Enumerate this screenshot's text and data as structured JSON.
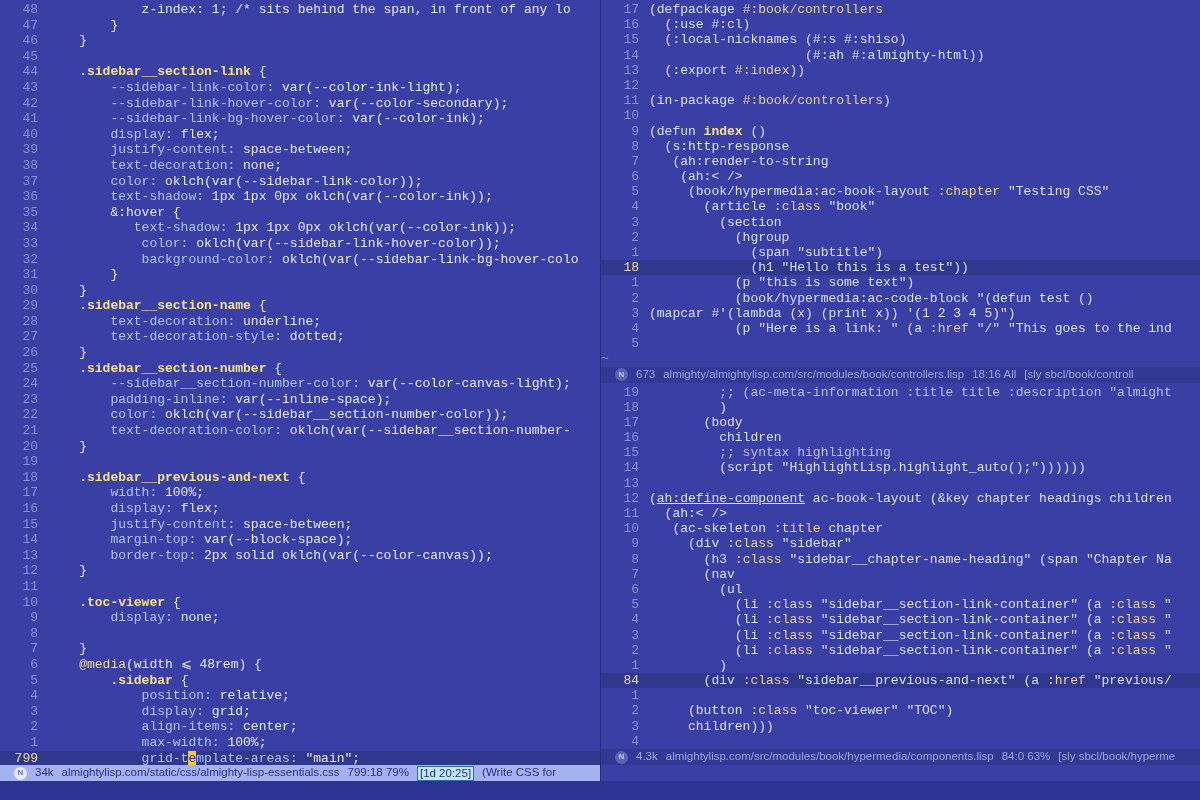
{
  "panes": [
    {
      "lines": [
        {
          "number": "48",
          "current": false,
          "segments": [
            {
              "kind": "val",
              "text": "            z-index: 1; /* sits behind the span, in front of any lo"
            }
          ]
        },
        {
          "number": "47",
          "current": false,
          "segments": [
            {
              "kind": "val",
              "text": "        }"
            }
          ]
        },
        {
          "number": "46",
          "current": false,
          "segments": [
            {
              "kind": "val",
              "text": "    }"
            }
          ]
        },
        {
          "number": "45",
          "current": false
        },
        {
          "number": "44",
          "current": false,
          "segments": [
            {
              "kind": "sel",
              "text": "    .sidebar__section-link"
            },
            {
              "kind": "val",
              "text": " {"
            }
          ]
        },
        {
          "number": "43",
          "current": false,
          "segments": [
            {
              "kind": "prop",
              "text": "        --sidebar-link-color:"
            },
            {
              "kind": "val",
              "text": " var(--color-ink-light);"
            }
          ]
        },
        {
          "number": "42",
          "current": false,
          "segments": [
            {
              "kind": "prop",
              "text": "        --sidebar-link-hover-color:"
            },
            {
              "kind": "val",
              "text": " var(--color-secondary);"
            }
          ]
        },
        {
          "number": "41",
          "current": false,
          "segments": [
            {
              "kind": "prop",
              "text": "        --sidebar-link-bg-hover-color:"
            },
            {
              "kind": "val",
              "text": " var(--color-ink);"
            }
          ]
        },
        {
          "number": "40",
          "current": false,
          "segments": [
            {
              "kind": "prop",
              "text": "        display:"
            },
            {
              "kind": "val",
              "text": " flex;"
            }
          ]
        },
        {
          "number": "39",
          "current": false,
          "segments": [
            {
              "kind": "prop",
              "text": "        justify-content:"
            },
            {
              "kind": "val",
              "text": " space-between;"
            }
          ]
        },
        {
          "number": "38",
          "current": false,
          "segments": [
            {
              "kind": "prop",
              "text": "        text-decoration:"
            },
            {
              "kind": "val",
              "text": " none;"
            }
          ]
        },
        {
          "number": "37",
          "current": false,
          "segments": [
            {
              "kind": "prop",
              "text": "        color:"
            },
            {
              "kind": "val",
              "text": " oklch(var(--sidebar-link-color));"
            }
          ]
        },
        {
          "number": "36",
          "current": false,
          "segments": [
            {
              "kind": "prop",
              "text": "        text-shadow:"
            },
            {
              "kind": "val",
              "text": " 1px 1px 0px oklch(var(--color-ink));"
            }
          ]
        },
        {
          "number": "35",
          "current": false,
          "segments": [
            {
              "kind": "val",
              "text": "        &:hover {"
            }
          ]
        },
        {
          "number": "34",
          "current": false,
          "segments": [
            {
              "kind": "prop",
              "text": "           text-shadow:"
            },
            {
              "kind": "val",
              "text": " 1px 1px 0px oklch(var(--color-ink));"
            }
          ]
        },
        {
          "number": "33",
          "current": false,
          "segments": [
            {
              "kind": "prop",
              "text": "            color:"
            },
            {
              "kind": "val",
              "text": " oklch(var(--sidebar-link-hover-color));"
            }
          ]
        },
        {
          "number": "32",
          "current": false,
          "segments": [
            {
              "kind": "prop",
              "text": "            background-color:"
            },
            {
              "kind": "val",
              "text": " oklch(var(--sidebar-link-bg-hover-colo"
            }
          ]
        },
        {
          "number": "31",
          "current": false,
          "segments": [
            {
              "kind": "val",
              "text": "        }"
            }
          ]
        },
        {
          "number": "30",
          "current": false,
          "segments": [
            {
              "kind": "val",
              "text": "    }"
            }
          ]
        },
        {
          "number": "29",
          "current": false,
          "segments": [
            {
              "kind": "sel",
              "text": "    .sidebar__section-name"
            },
            {
              "kind": "val",
              "text": " {"
            }
          ]
        },
        {
          "number": "28",
          "current": false,
          "segments": [
            {
              "kind": "prop",
              "text": "        text-decoration:"
            },
            {
              "kind": "val",
              "text": " underline;"
            }
          ]
        },
        {
          "number": "27",
          "current": false,
          "segments": [
            {
              "kind": "prop",
              "text": "        text-decoration-style:"
            },
            {
              "kind": "val",
              "text": " dotted;"
            }
          ]
        },
        {
          "number": "26",
          "current": false,
          "segments": [
            {
              "kind": "val",
              "text": "    }"
            }
          ]
        },
        {
          "number": "25",
          "current": false,
          "segments": [
            {
              "kind": "sel",
              "text": "    .sidebar__section-number"
            },
            {
              "kind": "val",
              "text": " {"
            }
          ]
        },
        {
          "number": "24",
          "current": false,
          "segments": [
            {
              "kind": "prop",
              "text": "        --sidebar__section-number-color:"
            },
            {
              "kind": "val",
              "text": " var(--color-canvas-light);"
            }
          ]
        },
        {
          "number": "23",
          "current": false,
          "segments": [
            {
              "kind": "prop",
              "text": "        padding-inline:"
            },
            {
              "kind": "val",
              "text": " var(--inline-space);"
            }
          ]
        },
        {
          "number": "22",
          "current": false,
          "segments": [
            {
              "kind": "prop",
              "text": "        color:"
            },
            {
              "kind": "val",
              "text": " oklch(var(--sidebar__section-number-color));"
            }
          ]
        },
        {
          "number": "21",
          "current": false,
          "segments": [
            {
              "kind": "prop",
              "text": "        text-decoration-color:"
            },
            {
              "kind": "val",
              "text": " oklch(var(--sidebar__section-number-"
            }
          ]
        },
        {
          "number": "20",
          "current": false,
          "segments": [
            {
              "kind": "val",
              "text": "    }"
            }
          ]
        },
        {
          "number": "19",
          "current": false
        },
        {
          "number": "18",
          "current": false,
          "segments": [
            {
              "kind": "sel",
              "text": "    .sidebar__previous-and-next"
            },
            {
              "kind": "val",
              "text": " {"
            }
          ]
        },
        {
          "number": "17",
          "current": false,
          "segments": [
            {
              "kind": "prop",
              "text": "        width:"
            },
            {
              "kind": "val",
              "text": " 100%;"
            }
          ]
        },
        {
          "number": "16",
          "current": false,
          "segments": [
            {
              "kind": "prop",
              "text": "        display:"
            },
            {
              "kind": "val",
              "text": " flex;"
            }
          ]
        },
        {
          "number": "15",
          "current": false,
          "segments": [
            {
              "kind": "prop",
              "text": "        justify-content:"
            },
            {
              "kind": "val",
              "text": " space-between;"
            }
          ]
        },
        {
          "number": "14",
          "current": false,
          "segments": [
            {
              "kind": "prop",
              "text": "        margin-top:"
            },
            {
              "kind": "val",
              "text": " var(--block-space);"
            }
          ]
        },
        {
          "number": "13",
          "current": false,
          "segments": [
            {
              "kind": "prop",
              "text": "        border-top:"
            },
            {
              "kind": "val",
              "text": " 2px solid oklch(var(--color-canvas));"
            }
          ]
        },
        {
          "number": "12",
          "current": false,
          "segments": [
            {
              "kind": "val",
              "text": "    }"
            }
          ]
        },
        {
          "number": "11",
          "current": false
        },
        {
          "number": "10",
          "current": false,
          "segments": [
            {
              "kind": "sel",
              "text": "    .toc-viewer"
            },
            {
              "kind": "val",
              "text": " {"
            }
          ]
        },
        {
          "number": "9",
          "current": false,
          "segments": [
            {
              "kind": "prop",
              "text": "        display:"
            },
            {
              "kind": "val",
              "text": " none;"
            }
          ]
        },
        {
          "number": "8",
          "current": false
        },
        {
          "number": "7",
          "current": false,
          "segments": [
            {
              "kind": "val",
              "text": "    }"
            }
          ]
        },
        {
          "number": "6",
          "current": false,
          "segments": [
            {
              "kind": "at",
              "text": "    @media"
            },
            {
              "kind": "val",
              "text": "(width ⩽ 48rem) {"
            }
          ]
        },
        {
          "number": "5",
          "current": false,
          "segments": [
            {
              "kind": "sel",
              "text": "        .sidebar"
            },
            {
              "kind": "val",
              "text": " {"
            }
          ]
        },
        {
          "number": "4",
          "current": false,
          "segments": [
            {
              "kind": "prop",
              "text": "            position:"
            },
            {
              "kind": "val",
              "text": " relative;"
            }
          ]
        },
        {
          "number": "3",
          "current": false,
          "segments": [
            {
              "kind": "prop",
              "text": "            display:"
            },
            {
              "kind": "val",
              "text": " grid;"
            }
          ]
        },
        {
          "number": "2",
          "current": false,
          "segments": [
            {
              "kind": "prop",
              "text": "            align-items:"
            },
            {
              "kind": "val",
              "text": " center;"
            }
          ]
        },
        {
          "number": "1",
          "current": false,
          "segments": [
            {
              "kind": "prop",
              "text": "            max-width:"
            },
            {
              "kind": "val",
              "text": " 100%;"
            }
          ]
        },
        {
          "number": "799",
          "current": true,
          "segments": [
            {
              "kind": "prop",
              "text": "            grid-t"
            },
            {
              "kind": "cursor",
              "text": "e"
            },
            {
              "kind": "prop",
              "text": "mplate-areas:"
            },
            {
              "kind": "val",
              "text": " \"main\";"
            }
          ]
        }
      ],
      "status_bar": {
        "active": true,
        "mode": "N",
        "size": "34k",
        "file": "almightylisp.com/static/css/almighty-lisp-essentials.css",
        "position": "799:18 79%",
        "clock": "[1d 20:25]",
        "message": "(Write CSS for"
      }
    },
    {
      "lines": [
        {
          "number": "17",
          "current": false,
          "segments": [
            {
              "kind": "code",
              "text": "(defpackage "
            },
            {
              "kind": "kw",
              "text": "#:book/controllers"
            }
          ]
        },
        {
          "number": "16",
          "current": false,
          "segments": [
            {
              "kind": "code",
              "text": "  (:use #:cl)"
            }
          ]
        },
        {
          "number": "15",
          "current": false,
          "segments": [
            {
              "kind": "code",
              "text": "  (:local-nicknames (#:s #:shiso)"
            }
          ]
        },
        {
          "number": "14",
          "current": false,
          "segments": [
            {
              "kind": "code",
              "text": "                    (#:ah #:almighty-html))"
            }
          ]
        },
        {
          "number": "13",
          "current": false,
          "segments": [
            {
              "kind": "code",
              "text": "  (:export "
            },
            {
              "kind": "kw",
              "text": "#:index"
            },
            {
              "kind": "code",
              "text": "))"
            }
          ]
        },
        {
          "number": "12",
          "current": false
        },
        {
          "number": "11",
          "current": false,
          "segments": [
            {
              "kind": "code",
              "text": "(in-package "
            },
            {
              "kind": "kw",
              "text": "#:book/controllers"
            },
            {
              "kind": "code",
              "text": ")"
            }
          ]
        },
        {
          "number": "10",
          "current": false
        },
        {
          "number": "9",
          "current": false,
          "segments": [
            {
              "kind": "code",
              "text": "(defun "
            },
            {
              "kind": "fn",
              "text": "index"
            },
            {
              "kind": "code",
              "text": " ()"
            }
          ]
        },
        {
          "number": "8",
          "current": false,
          "segments": [
            {
              "kind": "code",
              "text": "  (s:http-response"
            }
          ]
        },
        {
          "number": "7",
          "current": false,
          "segments": [
            {
              "kind": "code",
              "text": "   (ah:render-to-string"
            }
          ]
        },
        {
          "number": "6",
          "current": false,
          "segments": [
            {
              "kind": "code",
              "text": "    (ah:< />"
            }
          ]
        },
        {
          "number": "5",
          "current": false,
          "segments": [
            {
              "kind": "code",
              "text": "     (book/hypermedia:ac-book-layout "
            },
            {
              "kind": "kw",
              "text": ":chapter"
            },
            {
              "kind": "code",
              "text": " \"Testing CSS\""
            }
          ]
        },
        {
          "number": "4",
          "current": false,
          "segments": [
            {
              "kind": "code",
              "text": "       (article "
            },
            {
              "kind": "kw",
              "text": ":class"
            },
            {
              "kind": "code",
              "text": " \"book\""
            }
          ]
        },
        {
          "number": "3",
          "current": false,
          "segments": [
            {
              "kind": "code",
              "text": "         (section"
            }
          ]
        },
        {
          "number": "2",
          "current": false,
          "segments": [
            {
              "kind": "code",
              "text": "           (hgroup"
            }
          ]
        },
        {
          "number": "1",
          "current": false,
          "segments": [
            {
              "kind": "code",
              "text": "             (span \"subtitle\")"
            }
          ]
        },
        {
          "number": "18",
          "current": true,
          "segments": [
            {
              "kind": "code",
              "text": "             (h1 \"Hello this is a test\"))"
            }
          ]
        },
        {
          "number": "1",
          "current": false,
          "segments": [
            {
              "kind": "code",
              "text": "           (p \"this is some text\")"
            }
          ]
        },
        {
          "number": "2",
          "current": false,
          "segments": [
            {
              "kind": "code",
              "text": "           (book/hypermedia:ac-code-block \"(defun test ()"
            }
          ]
        },
        {
          "number": "3",
          "current": false,
          "segments": [
            {
              "kind": "code",
              "text": "(mapcar #'(lambda (x) (print x)) '(1 2 3 4 5)\")"
            }
          ]
        },
        {
          "number": "4",
          "current": false,
          "segments": [
            {
              "kind": "code",
              "text": "           (p \"Here is a link: \" (a "
            },
            {
              "kind": "kw",
              "text": ":href"
            },
            {
              "kind": "code",
              "text": " \"/\" \"This goes to the ind"
            }
          ]
        },
        {
          "number": "5",
          "current": false
        }
      ],
      "end_marker": "~",
      "status_bar": {
        "active": false,
        "mode": "N",
        "size": "673",
        "file": "almighty/almightylisp.com/src/modules/book/controllers.lisp",
        "position": "18:16 All",
        "process": "[sly sbcl/book/controll"
      }
    },
    {
      "lines": [
        {
          "number": "19",
          "current": false,
          "segments": [
            {
              "kind": "comment",
              "text": "         ;; (ac-meta-information :title title :description \"almight"
            }
          ]
        },
        {
          "number": "18",
          "current": false,
          "segments": [
            {
              "kind": "code",
              "text": "         )"
            }
          ]
        },
        {
          "number": "17",
          "current": false,
          "segments": [
            {
              "kind": "code",
              "text": "       (body"
            }
          ]
        },
        {
          "number": "16",
          "current": false,
          "segments": [
            {
              "kind": "code",
              "text": "         children"
            }
          ]
        },
        {
          "number": "15",
          "current": false,
          "segments": [
            {
              "kind": "comment",
              "text": "         ;; syntax highlighting"
            }
          ]
        },
        {
          "number": "14",
          "current": false,
          "segments": [
            {
              "kind": "code",
              "text": "         (script \"HighlightLisp.highlight_auto();\"))))))"
            }
          ]
        },
        {
          "number": "13",
          "current": false
        },
        {
          "number": "12",
          "current": false,
          "segments": [
            {
              "kind": "code",
              "text": "("
            },
            {
              "kind": "link",
              "text": "ah:define-component"
            },
            {
              "kind": "code",
              "text": " ac-book-layout (&key chapter headings children"
            }
          ]
        },
        {
          "number": "11",
          "current": false,
          "segments": [
            {
              "kind": "code",
              "text": "  (ah:< />"
            }
          ]
        },
        {
          "number": "10",
          "current": false,
          "segments": [
            {
              "kind": "code",
              "text": "   (ac-skeleton "
            },
            {
              "kind": "kw",
              "text": ":title"
            },
            {
              "kind": "code",
              "text": " chapter"
            }
          ]
        },
        {
          "number": "9",
          "current": false,
          "segments": [
            {
              "kind": "code",
              "text": "     (div "
            },
            {
              "kind": "kw",
              "text": ":class"
            },
            {
              "kind": "code",
              "text": " \"sidebar\""
            }
          ]
        },
        {
          "number": "8",
          "current": false,
          "segments": [
            {
              "kind": "code",
              "text": "       (h3 "
            },
            {
              "kind": "kw",
              "text": ":class"
            },
            {
              "kind": "code",
              "text": " \"sidebar__chapter-name-heading\" (span \"Chapter Na"
            }
          ]
        },
        {
          "number": "7",
          "current": false,
          "segments": [
            {
              "kind": "code",
              "text": "       (nav"
            }
          ]
        },
        {
          "number": "6",
          "current": false,
          "segments": [
            {
              "kind": "code",
              "text": "         (ul"
            }
          ]
        },
        {
          "number": "5",
          "current": false,
          "segments": [
            {
              "kind": "code",
              "text": "           (li "
            },
            {
              "kind": "kw",
              "text": ":class"
            },
            {
              "kind": "code",
              "text": " \"sidebar__section-link-container\" (a "
            },
            {
              "kind": "kw",
              "text": ":class"
            },
            {
              "kind": "code",
              "text": " \""
            }
          ]
        },
        {
          "number": "4",
          "current": false,
          "segments": [
            {
              "kind": "code",
              "text": "           (li "
            },
            {
              "kind": "kw",
              "text": ":class"
            },
            {
              "kind": "code",
              "text": " \"sidebar__section-link-container\" (a "
            },
            {
              "kind": "kw",
              "text": ":class"
            },
            {
              "kind": "code",
              "text": " \""
            }
          ]
        },
        {
          "number": "3",
          "current": false,
          "segments": [
            {
              "kind": "code",
              "text": "           (li "
            },
            {
              "kind": "kw",
              "text": ":class"
            },
            {
              "kind": "code",
              "text": " \"sidebar__section-link-container\" (a "
            },
            {
              "kind": "kw",
              "text": ":class"
            },
            {
              "kind": "code",
              "text": " \""
            }
          ]
        },
        {
          "number": "2",
          "current": false,
          "segments": [
            {
              "kind": "code",
              "text": "           (li "
            },
            {
              "kind": "kw",
              "text": ":class"
            },
            {
              "kind": "code",
              "text": " \"sidebar__section-link-container\" (a "
            },
            {
              "kind": "kw",
              "text": ":class"
            },
            {
              "kind": "code",
              "text": " \""
            }
          ]
        },
        {
          "number": "1",
          "current": false,
          "segments": [
            {
              "kind": "code",
              "text": "         )"
            }
          ]
        },
        {
          "number": "84",
          "current": true,
          "segments": [
            {
              "kind": "code",
              "text": "       (div "
            },
            {
              "kind": "kw",
              "text": ":class"
            },
            {
              "kind": "code",
              "text": " \"sidebar__previous-and-next\" (a "
            },
            {
              "kind": "kw",
              "text": ":href"
            },
            {
              "kind": "code",
              "text": " \"previous/"
            }
          ]
        },
        {
          "number": "1",
          "current": false
        },
        {
          "number": "2",
          "current": false,
          "segments": [
            {
              "kind": "code",
              "text": "     (button "
            },
            {
              "kind": "kw",
              "text": ":class"
            },
            {
              "kind": "code",
              "text": " \"toc-viewer\" \"TOC\")"
            }
          ]
        },
        {
          "number": "3",
          "current": false,
          "segments": [
            {
              "kind": "code",
              "text": "     children)))"
            }
          ]
        },
        {
          "number": "4",
          "current": false
        }
      ],
      "status_bar": {
        "active": false,
        "mode": "N",
        "size": "4.3k",
        "file": "almightylisp.com/src/modules/book/hypermedia/components.lisp",
        "position": "84:0 63%",
        "process": "[sly sbcl/book/hyperme"
      }
    }
  ]
}
